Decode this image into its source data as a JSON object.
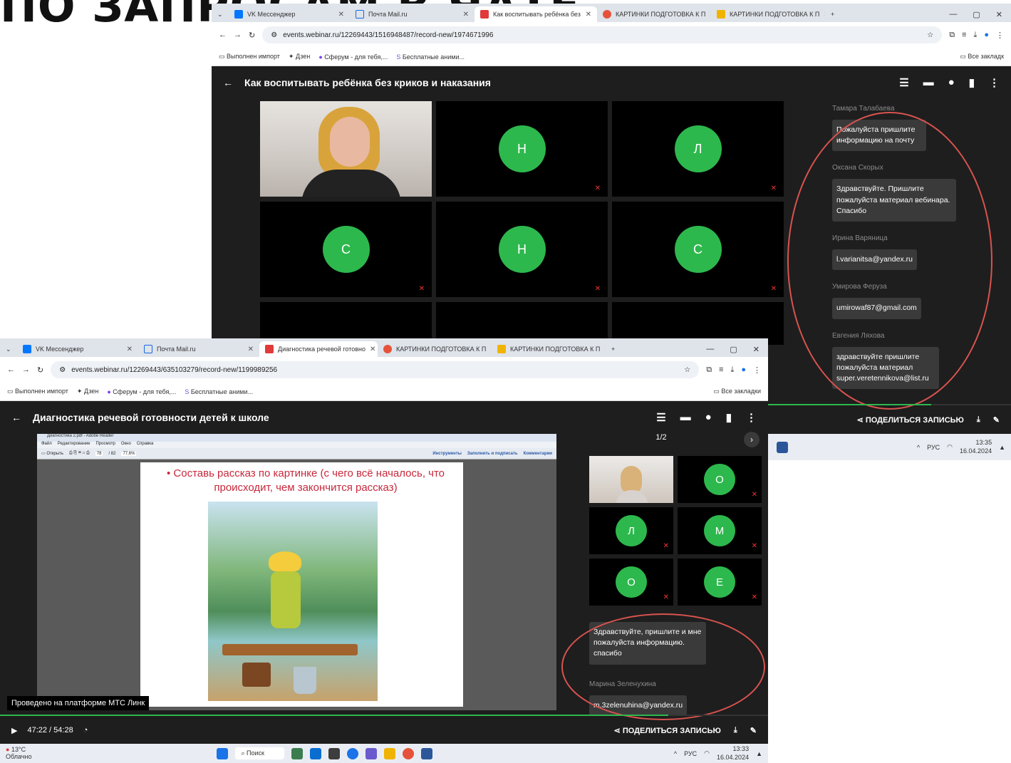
{
  "slide_title": "ПО ЗАПРОСАМ В ЧАТЕ",
  "tabs_common": {
    "vk": "VK Мессенджер",
    "mail": "Почта Mail.ru",
    "kart1": "КАРТИНКИ ПОДГОТОВКА К П",
    "kart2": "КАРТИНКИ ПОДГОТОВКА К П"
  },
  "bookmarks": {
    "import": "Выполнен импорт",
    "dzen": "Дзен",
    "sferum": "Сферум - для тебя,...",
    "anim": "Бесплатные аними...",
    "all1": "Все закладк",
    "all2": "Все закладки"
  },
  "w1": {
    "tab": "Как воспитывать ребёнка без",
    "url": "events.webinar.ru/12269443/1516948487/record-new/1974671996",
    "title": "Как воспитывать ребёнка без криков и наказания",
    "avatars": [
      "Н",
      "Л",
      "С",
      "Н",
      "С"
    ],
    "chat": [
      {
        "name": "Тамара Талабаева",
        "text": "Пожалуйста пришлите информацию на почту"
      },
      {
        "name": "Оксана Скорых",
        "text": "Здравствуйте. Пришлите пожалуйста материал вебинара. Спасибо"
      },
      {
        "name": "Ирина Варяница",
        "text": "l.varianitsa@yandex.ru"
      },
      {
        "name": "Умирова Феруза",
        "text": "umirowaf87@gmail.com"
      },
      {
        "name": "Евгения Ляхова",
        "text": "здравствуйте пришлите пожалуйста материал super.veretennikova@list.ru"
      }
    ],
    "share": "ПОДЕЛИТЬСЯ ЗАПИСЬЮ",
    "lang": "РУС",
    "time": "13:35",
    "date": "16.04.2024"
  },
  "w2": {
    "tab": "Диагностика речевой готовно",
    "url": "events.webinar.ru/12269443/635103279/record-new/1199989256",
    "title": "Диагностика речевой готовности детей к школе",
    "pdf": {
      "file": "Диагностика 2.pdf - Adobe Reader",
      "menu": [
        "Файл",
        "Редактирование",
        "Просмотр",
        "Окно",
        "Справка"
      ],
      "open": "Открыть",
      "page": "78",
      "pages": "/ 82",
      "zoom": "77,6%",
      "tools": [
        "Инструменты",
        "Заполнить и подписать",
        "Комментарии"
      ],
      "slide_text": "• Составь рассказ по картинке  (с чего всё началось, что происходит, чем закончится  рассказ)"
    },
    "page_ind": "1/2",
    "avatars": [
      "О",
      "Л",
      "М",
      "О",
      "Е"
    ],
    "chat": [
      {
        "name": "",
        "text": "Здравствуйте, пришлите и мне пожалуйста информацию. спасибо"
      },
      {
        "name": "Марина Зеленухина",
        "text": "m.3zelenuhina@yandex.ru"
      }
    ],
    "platform": "Проведено на платформе МТС Линк",
    "progress": "47:22 / 54:28",
    "share": "ПОДЕЛИТЬСЯ ЗАПИСЬЮ",
    "weather": "13°C",
    "weather2": "Облачно",
    "search": "Поиск",
    "lang": "РУС",
    "time": "13:33",
    "date": "16.04.2024"
  }
}
